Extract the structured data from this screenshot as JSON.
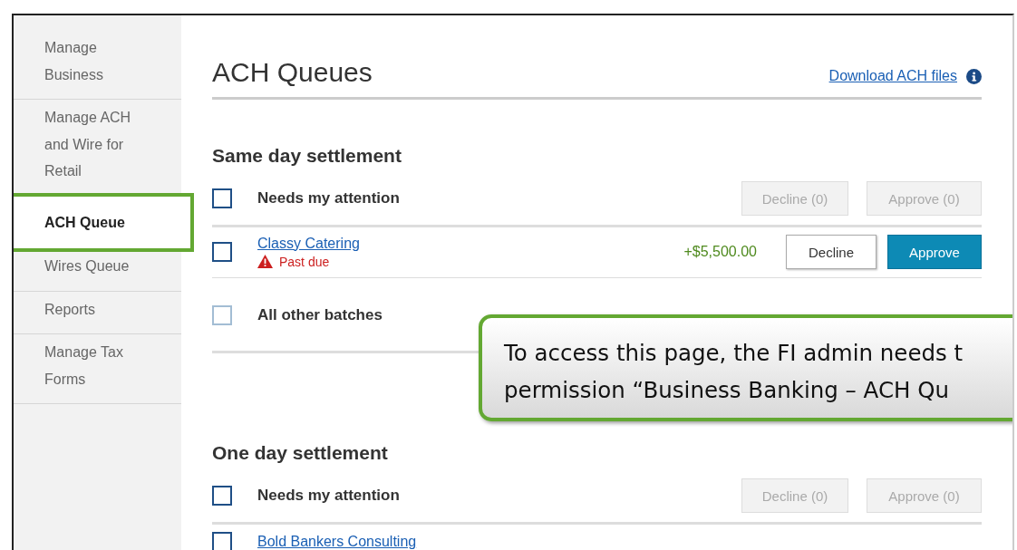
{
  "sidebar": {
    "items": [
      {
        "label": "Manage Business",
        "selected": false,
        "highlighted": false
      },
      {
        "label": "Manage ACH and Wire for Retail",
        "selected": false,
        "highlighted": false
      },
      {
        "label": "ACH Queue",
        "selected": true,
        "highlighted": true
      },
      {
        "label": "Wires Queue",
        "selected": false,
        "highlighted": false
      },
      {
        "label": "Reports",
        "selected": false,
        "highlighted": false
      },
      {
        "label": "Manage Tax Forms",
        "selected": false,
        "highlighted": false
      }
    ]
  },
  "page": {
    "title": "ACH Queues",
    "download_link": "Download ACH files"
  },
  "sections": [
    {
      "title": "Same day settlement",
      "groups": [
        {
          "label": "Needs my attention",
          "checked": false,
          "disabled": false,
          "decline": "Decline (0)",
          "approve": "Approve (0)",
          "rows": [
            {
              "name": "Classy Catering",
              "checked": false,
              "status": "Past due",
              "amount": "+$5,500.00",
              "decline": "Decline",
              "approve": "Approve"
            }
          ]
        },
        {
          "label": "All other batches",
          "checked": false,
          "disabled": true
        }
      ]
    },
    {
      "title": "One day settlement",
      "groups": [
        {
          "label": "Needs my attention",
          "checked": false,
          "disabled": false,
          "decline": "Decline (0)",
          "approve": "Approve (0)",
          "rows": [
            {
              "name": "Bold Bankers Consulting",
              "checked": false
            }
          ]
        }
      ]
    }
  ],
  "callout": {
    "lines": [
      "To access this page, the FI admin needs t",
      "permission “Business Banking – ACH Qu"
    ]
  }
}
